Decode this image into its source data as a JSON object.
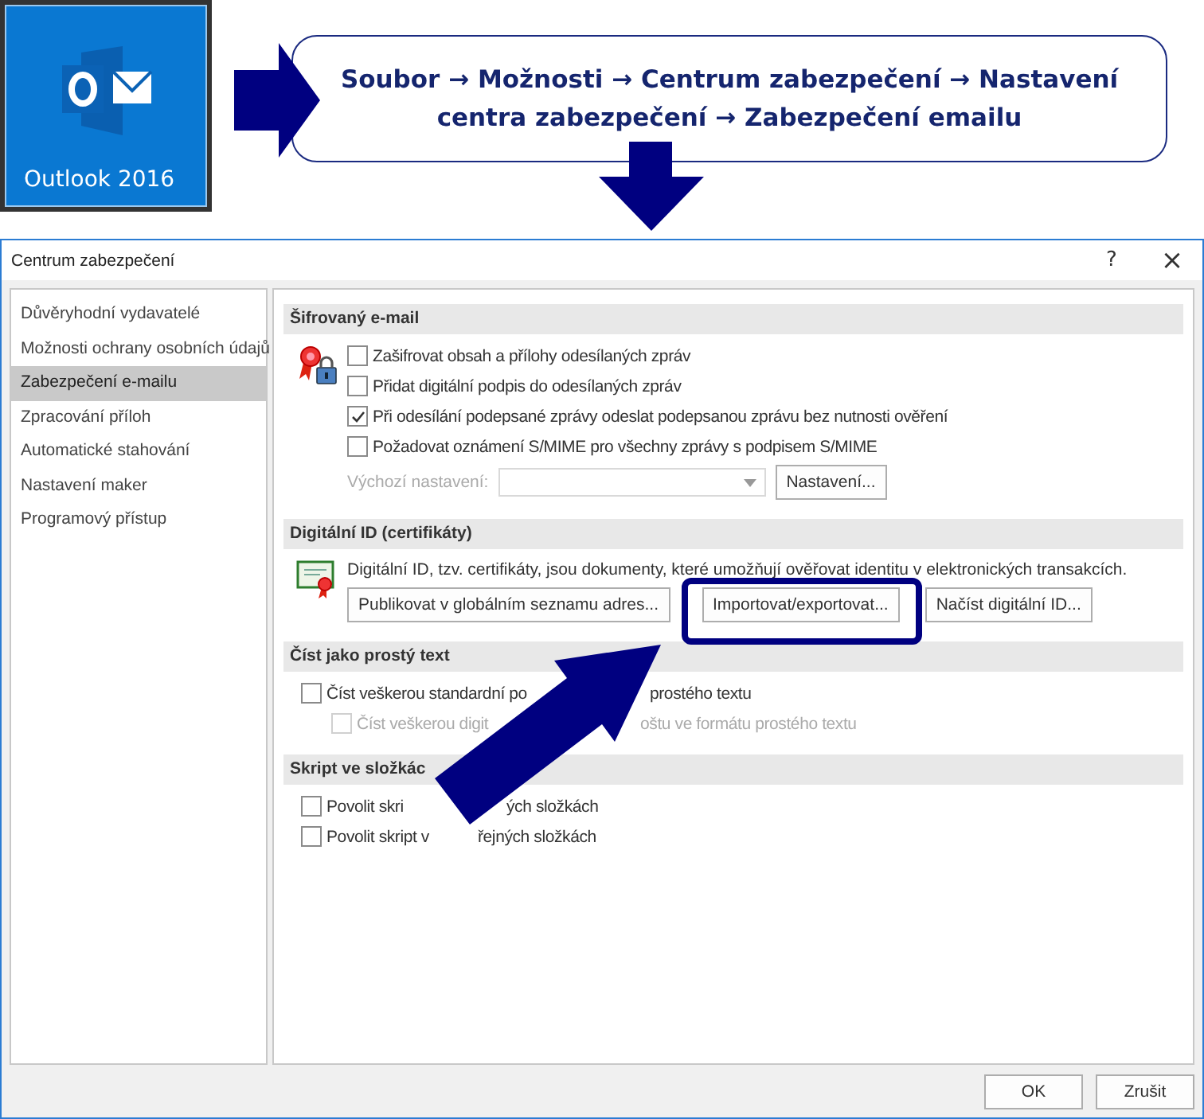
{
  "tile": {
    "label": "Outlook 2016"
  },
  "path_box": {
    "lines": [
      "Soubor → Možnosti → Centrum zabezpečení → Nastavení",
      "centra zabezpečení → Zabezpečení emailu"
    ]
  },
  "dialog": {
    "title": "Centrum zabezpečení",
    "help_button": "?",
    "close_button": "×"
  },
  "sidebar": {
    "items": [
      {
        "label": "Důvěryhodní vydavatelé",
        "selected": false
      },
      {
        "label": "Možnosti ochrany osobních údajů",
        "selected": false
      },
      {
        "label": "Zabezpečení e-mailu",
        "selected": true
      },
      {
        "label": "Zpracování příloh",
        "selected": false
      },
      {
        "label": "Automatické stahování",
        "selected": false
      },
      {
        "label": "Nastavení maker",
        "selected": false
      },
      {
        "label": "Programový přístup",
        "selected": false
      }
    ]
  },
  "sections": [
    {
      "kind": "encryption",
      "title": "Šifrovaný e-mail",
      "rows": [
        {
          "kind": "checkbox",
          "label": "Zašifrovat obsah a přílohy odesílaných zpráv",
          "checked": false,
          "disabled": false
        },
        {
          "kind": "checkbox",
          "label": "Přidat digitální podpis do odesílaných zpráv",
          "checked": false,
          "disabled": false
        },
        {
          "kind": "checkbox",
          "label": "Při odesílání podepsané zprávy odeslat podepsanou zprávu bez nutnosti ověření",
          "checked": true,
          "disabled": false
        },
        {
          "kind": "checkbox",
          "label": "Požadovat oznámení S/MIME pro všechny zprávy s podpisem S/MIME",
          "checked": false,
          "disabled": false
        },
        {
          "kind": "dropdown",
          "label": "Výchozí nastavení:",
          "disabled": true,
          "button": "Nastavení..."
        }
      ]
    },
    {
      "kind": "digital_id",
      "title": "Digitální ID (certifikáty)",
      "rows": [
        {
          "kind": "text",
          "label": "Digitální ID, tzv. certifikáty, jsou dokumenty, které umožňují ověřovat identitu v elektronických transakcích."
        },
        {
          "kind": "buttons",
          "buttons": [
            {
              "label": "Publikovat v globálním seznamu adres...",
              "highlighted": false
            },
            {
              "label": "Importovat/exportovat...",
              "highlighted": true
            },
            {
              "label": "Načíst digitální ID...",
              "highlighted": false
            }
          ]
        }
      ]
    },
    {
      "kind": "plain_text",
      "title": "Číst jako prostý text",
      "rows": [
        {
          "kind": "checkbox",
          "label": "Číst veškerou standardní po",
          "label_end": "prostého textu",
          "checked": false,
          "disabled": false,
          "children": [
            {
              "kind": "checkbox",
              "label": "Číst veškerou digit",
              "label_end": "oštu ve formátu prostého textu",
              "checked": false,
              "disabled": true
            }
          ]
        }
      ]
    },
    {
      "kind": "script",
      "title": "Skript ve složkác",
      "rows": [
        {
          "kind": "checkbox",
          "label": "Povolit skri",
          "label_end": "ých složkách",
          "checked": false,
          "disabled": false
        },
        {
          "kind": "checkbox",
          "label": "Povolit skript v",
          "label_end": "řejných složkách",
          "checked": false,
          "disabled": false
        }
      ]
    }
  ],
  "footer": {
    "buttons": [
      "OK",
      "Zrušit"
    ]
  }
}
